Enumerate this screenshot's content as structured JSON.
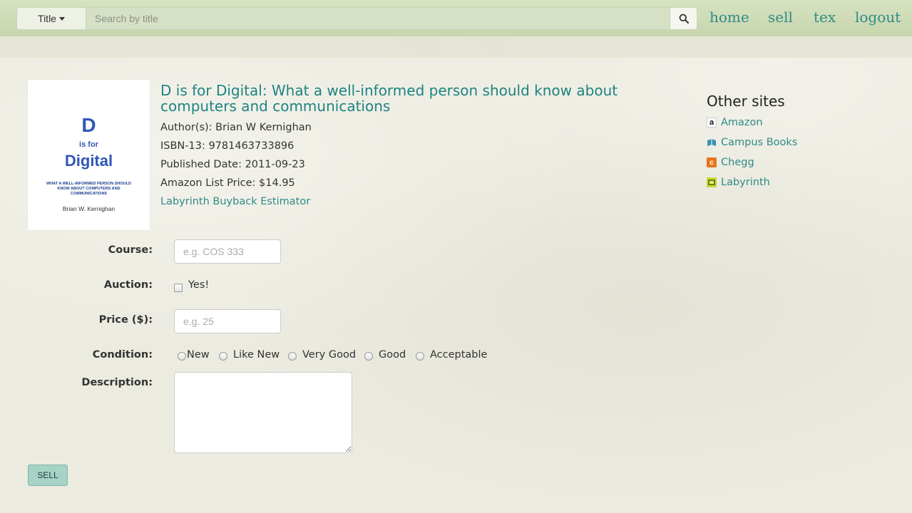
{
  "header": {
    "search_type": "Title",
    "search_placeholder": "Search by title",
    "nav": [
      {
        "label": "home"
      },
      {
        "label": "sell"
      },
      {
        "label": "tex"
      },
      {
        "label": "logout"
      }
    ]
  },
  "book": {
    "cover": {
      "big_letter": "D",
      "is_for": "is for",
      "word": "Digital",
      "subtitle": "WHAT A WELL-INFORMED PERSON SHOULD KNOW ABOUT COMPUTERS AND COMMUNICATIONS",
      "author": "Brian W. Kernighan"
    },
    "title": "D is for Digital: What a well-informed person should know about computers and communications",
    "author_line": "Author(s): Brian W Kernighan",
    "isbn_line": "ISBN-13: 9781463733896",
    "published_line": "Published Date: 2011-09-23",
    "price_line": "Amazon List Price: $14.95",
    "buyback_link": "Labyrinth Buyback Estimator"
  },
  "other_sites": {
    "heading": "Other sites",
    "items": [
      {
        "label": "Amazon",
        "icon": "amazon-icon"
      },
      {
        "label": "Campus Books",
        "icon": "campus-books-icon"
      },
      {
        "label": "Chegg",
        "icon": "chegg-icon"
      },
      {
        "label": "Labyrinth",
        "icon": "labyrinth-icon"
      }
    ]
  },
  "form": {
    "course_label": "Course:",
    "course_placeholder": "e.g. COS 333",
    "auction_label": "Auction:",
    "auction_option": "Yes!",
    "price_label": "Price ($):",
    "price_placeholder": "e.g. 25",
    "condition_label": "Condition:",
    "conditions": [
      "New",
      "Like New",
      "Very Good",
      "Good",
      "Acceptable"
    ],
    "description_label": "Description:",
    "submit_label": "SELL"
  },
  "colors": {
    "accent": "#2e8b86",
    "topbar": "#cfdcb8",
    "sell_button": "#a7d2c6"
  }
}
